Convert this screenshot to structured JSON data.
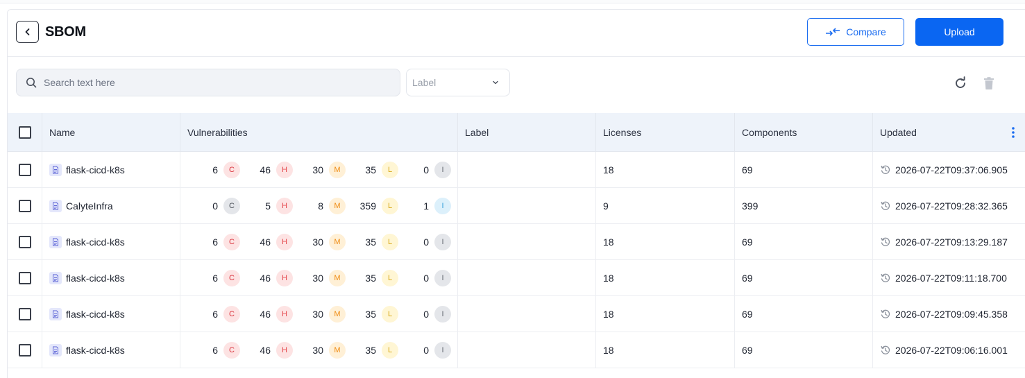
{
  "header": {
    "title": "SBOM",
    "compare_label": "Compare",
    "upload_label": "Upload"
  },
  "toolbar": {
    "search_placeholder": "Search text here",
    "label_select_placeholder": "Label"
  },
  "colors": {
    "primary": "#0a66f2",
    "critical": "#d9313a",
    "high": "#e5484d",
    "medium": "#ef8b12",
    "low": "#d6a410",
    "info": "#2a9ad8"
  },
  "table": {
    "columns": [
      "Name",
      "Vulnerabilities",
      "Label",
      "Licenses",
      "Components",
      "Updated"
    ],
    "rows": [
      {
        "name": "flask-cicd-k8s",
        "vulns": [
          "6",
          "46",
          "30",
          "35",
          "0"
        ],
        "label": "",
        "licenses": "18",
        "components": "69",
        "updated": "2026-07-22T09:37:06.905"
      },
      {
        "name": "CalyteInfra",
        "vulns": [
          "0",
          "5",
          "8",
          "359",
          "1"
        ],
        "label": "",
        "licenses": "9",
        "components": "399",
        "updated": "2026-07-22T09:28:32.365"
      },
      {
        "name": "flask-cicd-k8s",
        "vulns": [
          "6",
          "46",
          "30",
          "35",
          "0"
        ],
        "label": "",
        "licenses": "18",
        "components": "69",
        "updated": "2026-07-22T09:13:29.187"
      },
      {
        "name": "flask-cicd-k8s",
        "vulns": [
          "6",
          "46",
          "30",
          "35",
          "0"
        ],
        "label": "",
        "licenses": "18",
        "components": "69",
        "updated": "2026-07-22T09:11:18.700"
      },
      {
        "name": "flask-cicd-k8s",
        "vulns": [
          "6",
          "46",
          "30",
          "35",
          "0"
        ],
        "label": "",
        "licenses": "18",
        "components": "69",
        "updated": "2026-07-22T09:09:45.358"
      },
      {
        "name": "flask-cicd-k8s",
        "vulns": [
          "6",
          "46",
          "30",
          "35",
          "0"
        ],
        "label": "",
        "licenses": "18",
        "components": "69",
        "updated": "2026-07-22T09:06:16.001"
      }
    ]
  },
  "severity_letters": [
    "C",
    "H",
    "M",
    "L",
    "I"
  ]
}
